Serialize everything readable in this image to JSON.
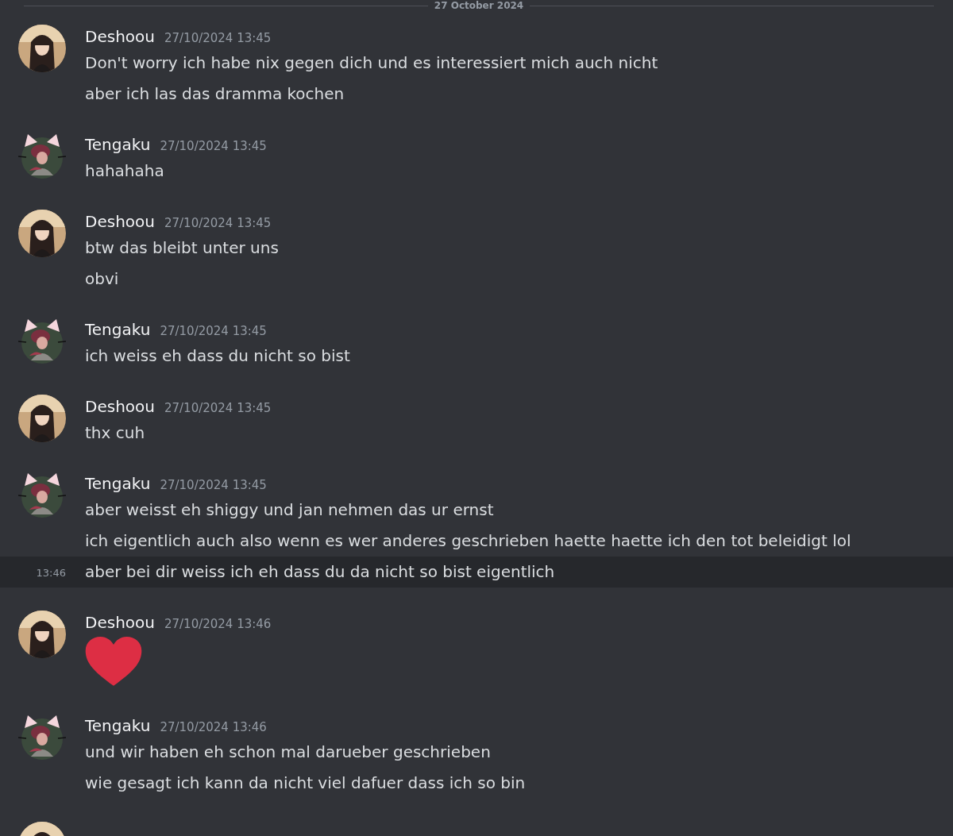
{
  "date_divider": "27 October 2024",
  "groups": [
    {
      "author": "Deshoou",
      "kind": "dark",
      "timestamp": "27/10/2024 13:45",
      "lines": [
        {
          "kind": "text",
          "text": "Don't worry ich habe nix gegen dich und es interessiert mich auch nicht",
          "hovered": false
        },
        {
          "kind": "text",
          "text": "aber ich las das dramma kochen",
          "hovered": false
        }
      ]
    },
    {
      "author": "Tengaku",
      "kind": "cat",
      "timestamp": "27/10/2024 13:45",
      "lines": [
        {
          "kind": "text",
          "text": "hahahaha",
          "hovered": false
        }
      ]
    },
    {
      "author": "Deshoou",
      "kind": "dark",
      "timestamp": "27/10/2024 13:45",
      "lines": [
        {
          "kind": "text",
          "text": "btw das bleibt unter uns",
          "hovered": false
        },
        {
          "kind": "text",
          "text": "obvi",
          "hovered": false
        }
      ]
    },
    {
      "author": "Tengaku",
      "kind": "cat",
      "timestamp": "27/10/2024 13:45",
      "lines": [
        {
          "kind": "text",
          "text": "ich weiss eh dass du nicht so bist",
          "hovered": false
        }
      ]
    },
    {
      "author": "Deshoou",
      "kind": "dark",
      "timestamp": "27/10/2024 13:45",
      "lines": [
        {
          "kind": "text",
          "text": "thx cuh",
          "hovered": false
        }
      ]
    },
    {
      "author": "Tengaku",
      "kind": "cat",
      "timestamp": "27/10/2024 13:45",
      "lines": [
        {
          "kind": "text",
          "text": "aber weisst eh shiggy und jan nehmen das ur ernst",
          "hovered": false
        },
        {
          "kind": "text",
          "text": "ich eigentlich auch also wenn es wer anderes geschrieben haette haette ich den tot beleidigt lol",
          "hovered": false
        },
        {
          "kind": "text",
          "text": "aber bei dir weiss ich eh dass du da nicht so bist eigentlich",
          "hovered": true,
          "time": "13:46"
        }
      ]
    },
    {
      "author": "Deshoou",
      "kind": "dark",
      "timestamp": "27/10/2024 13:46",
      "lines": [
        {
          "kind": "heart-emoji",
          "hovered": false
        }
      ]
    },
    {
      "author": "Tengaku",
      "kind": "cat",
      "timestamp": "27/10/2024 13:46",
      "lines": [
        {
          "kind": "text",
          "text": "und wir haben eh schon mal darueber geschrieben",
          "hovered": false
        },
        {
          "kind": "text",
          "text": "wie gesagt ich kann da nicht viel dafuer dass ich so bin",
          "hovered": false
        }
      ]
    },
    {
      "kind": "dark"
    }
  ]
}
